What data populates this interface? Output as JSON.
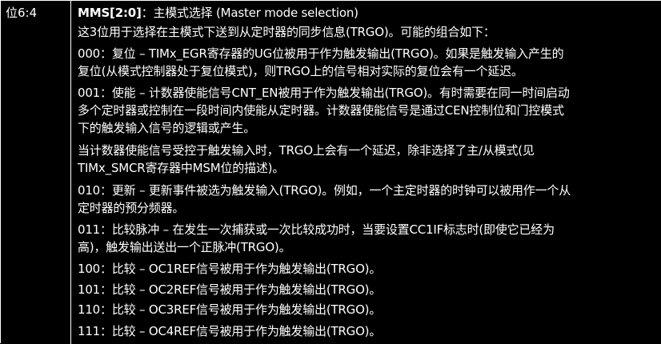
{
  "bit_field": "位6:4",
  "title": {
    "name": "MMS[2:0]",
    "description": "：主模式选择 (Master mode selection)"
  },
  "lines": [
    "这3位用于选择在主模式下送到从定时器的同步信息(TRGO)。可能的组合如下：",
    "000：复位 – TIMx_EGR寄存器的UG位被用于作为触发输出(TRGO)。如果是触发输入产生的",
    "复位(从模式控制器处于复位模式)，则TRGO上的信号相对实际的复位会有一个延迟。",
    "001：使能 – 计数器使能信号CNT_EN被用于作为触发输出(TRGO)。有时需要在同一时间启动",
    "多个定时器或控制在一段时间内使能从定时器。计数器使能信号是通过CEN控制位和门控模式",
    "下的触发输入信号的逻辑或产生。",
    "当计数器使能信号受控于触发输入时，TRGO上会有一个延迟，除非选择了主/从模式(见",
    "TIMx_SMCR寄存器中MSM位的描述)。",
    "010：更新 – 更新事件被选为触发输入(TRGO)。例如，一个主定时器的时钟可以被用作一个从",
    "定时器的预分频器。",
    "011：比较脉冲 – 在发生一次捕获或一次比较成功时，当要设置CC1IF标志时(即使它已经为",
    "高)，触发输出送出一个正脉冲(TRGO)。",
    "100：比较 – OC1REF信号被用于作为触发输出(TRGO)。",
    "101：比较 – OC2REF信号被用于作为触发输出(TRGO)。",
    "110：比较 – OC3REF信号被用于作为触发输出(TRGO)。",
    "111：比较 – OC4REF信号被用于作为触发输出(TRGO)。"
  ],
  "colors": {
    "background": "#000000",
    "text": "#ffffff",
    "border": "#ffffff"
  }
}
